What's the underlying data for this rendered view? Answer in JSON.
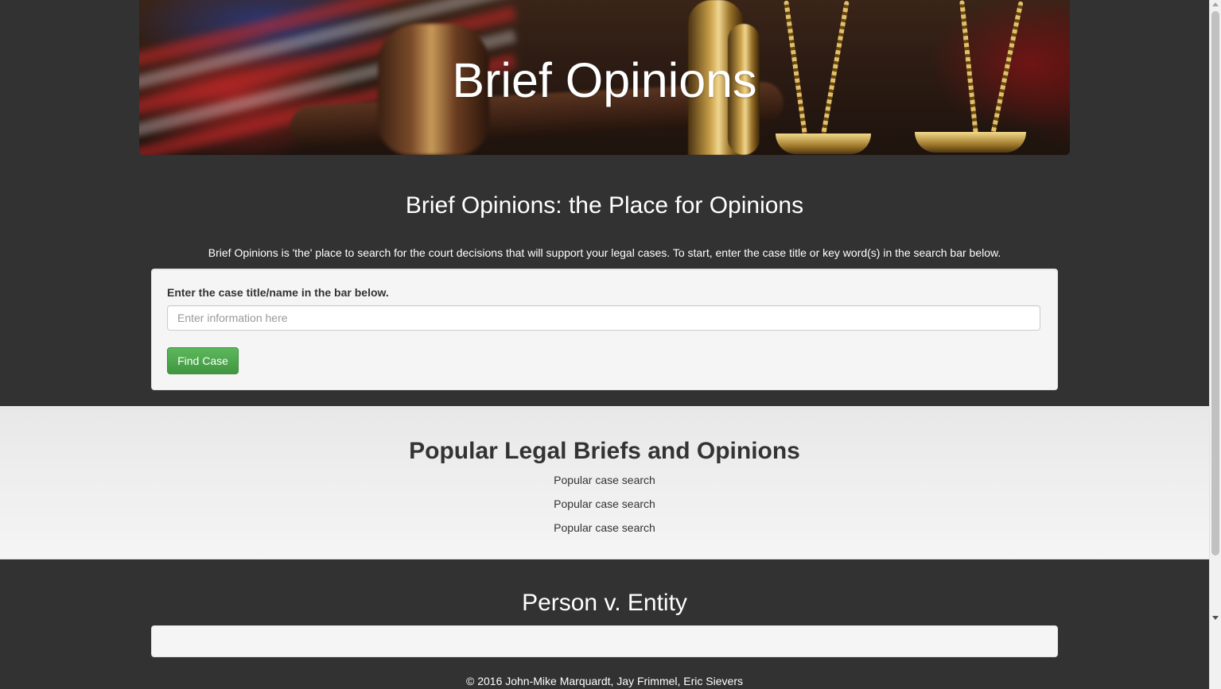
{
  "hero": {
    "title": "Brief Opinions"
  },
  "intro": {
    "heading": "Brief Opinions: the Place for Opinions",
    "description": "Brief Opinions is 'the' place to search for the court decisions that will support your legal cases. To start, enter the case title or key word(s) in the search bar below."
  },
  "search": {
    "label": "Enter the case title/name in the bar below.",
    "value": "",
    "placeholder": "Enter information here",
    "button_label": "Find Case"
  },
  "popular": {
    "heading": "Popular Legal Briefs and Opinions",
    "items": [
      {
        "label": "Popular case search"
      },
      {
        "label": "Popular case search"
      },
      {
        "label": "Popular case search"
      }
    ]
  },
  "case": {
    "heading": "Person v. Entity",
    "content": ""
  },
  "footer": {
    "copyright": "© 2016 John-Mike Marquardt, Jay Frimmel, Eric Sievers"
  },
  "colors": {
    "page_background": "#323232",
    "well_background": "#f5f5f5",
    "popular_background": "#eeeeee",
    "button_green": "#5cb85c",
    "text_dark": "#333333",
    "text_light": "#ffffff"
  },
  "icons": {
    "scroll_up": "triangle-up-icon",
    "scroll_down": "triangle-down-icon"
  }
}
